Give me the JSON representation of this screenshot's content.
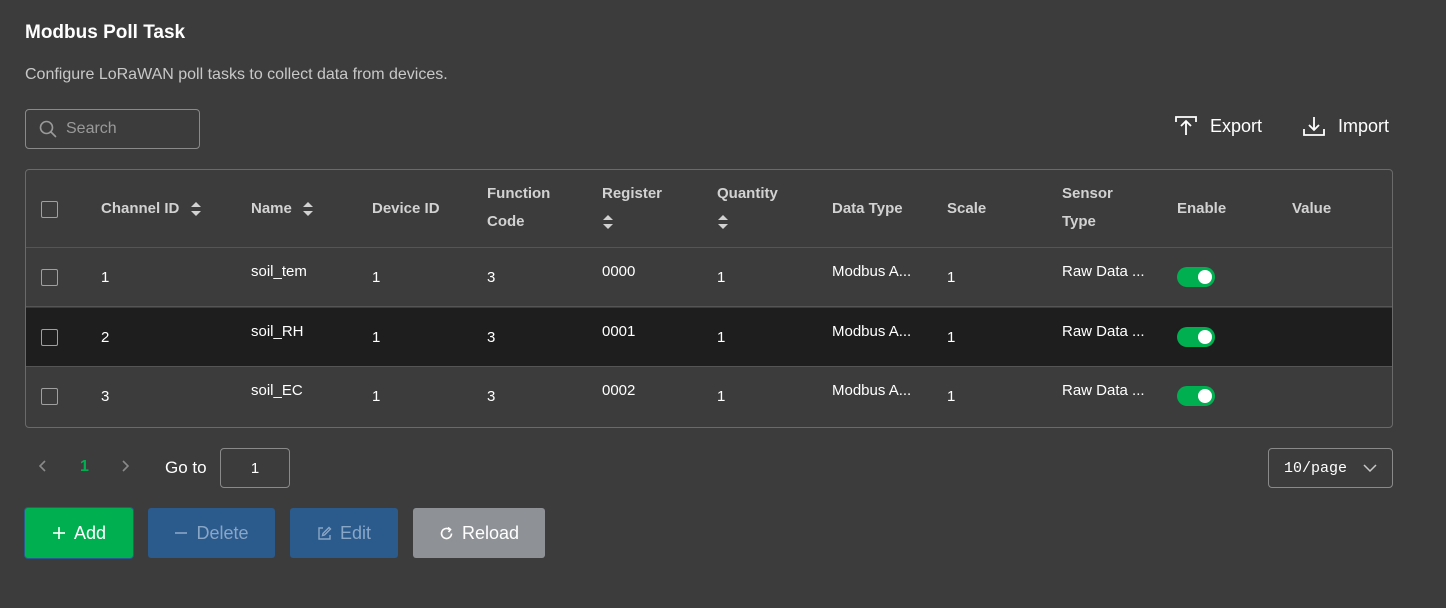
{
  "header": {
    "title": "Modbus Poll Task",
    "description": "Configure LoRaWAN poll tasks to collect data from devices."
  },
  "search": {
    "placeholder": "Search"
  },
  "actions": {
    "export_label": "Export",
    "import_label": "Import"
  },
  "table": {
    "columns": {
      "channel_id": "Channel ID",
      "name": "Name",
      "device_id": "Device ID",
      "function_code_1": "Function",
      "function_code_2": "Code",
      "register": "Register",
      "quantity": "Quantity",
      "data_type": "Data Type",
      "scale": "Scale",
      "sensor_type_1": "Sensor",
      "sensor_type_2": "Type",
      "enable": "Enable",
      "value": "Value"
    },
    "rows": [
      {
        "channel_id": "1",
        "name": "soil_tem",
        "device_id": "1",
        "function_code": "3",
        "register": "0000",
        "quantity": "1",
        "data_type": "Modbus A...",
        "scale": "1",
        "sensor_type": "Raw Data ...",
        "enabled": true,
        "value": ""
      },
      {
        "channel_id": "2",
        "name": "soil_RH",
        "device_id": "1",
        "function_code": "3",
        "register": "0001",
        "quantity": "1",
        "data_type": "Modbus A...",
        "scale": "1",
        "sensor_type": "Raw Data ...",
        "enabled": true,
        "value": ""
      },
      {
        "channel_id": "3",
        "name": "soil_EC",
        "device_id": "1",
        "function_code": "3",
        "register": "0002",
        "quantity": "1",
        "data_type": "Modbus A...",
        "scale": "1",
        "sensor_type": "Raw Data ...",
        "enabled": true,
        "value": ""
      }
    ]
  },
  "pagination": {
    "current_page": "1",
    "goto_label": "Go to",
    "goto_value": "1",
    "page_size": "10/page"
  },
  "buttons": {
    "add": "Add",
    "delete": "Delete",
    "edit": "Edit",
    "reload": "Reload"
  },
  "colors": {
    "background": "#3c3c3c",
    "accent": "#00b050",
    "secondary_button": "#2b5a8c",
    "reload_button": "#8e9196"
  }
}
